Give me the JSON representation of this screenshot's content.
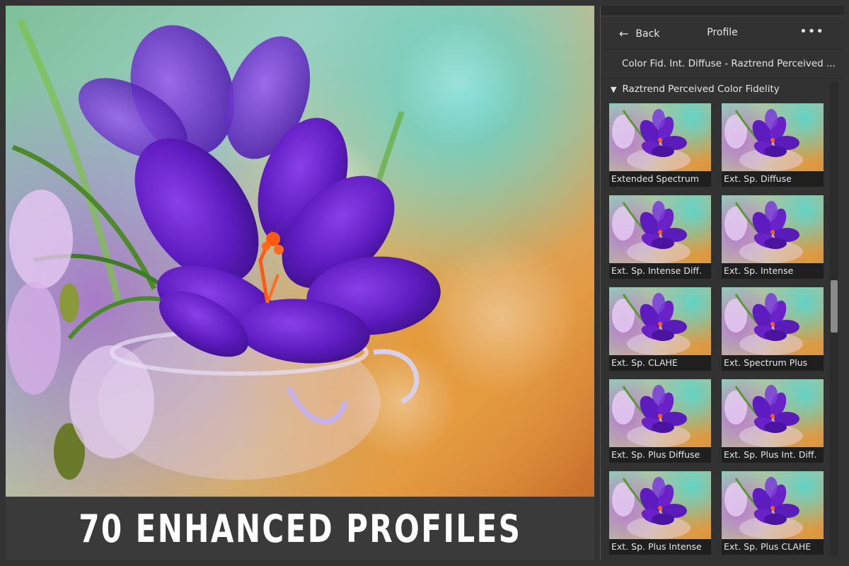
{
  "banner": {
    "text": "70 ENHANCED PROFILES"
  },
  "panel": {
    "back_label": "Back",
    "title": "Profile",
    "more_label": "•••",
    "current_profile": "Color Fid. Int. Diffuse - Raztrend Perceived ...",
    "group_title": "Raztrend Perceived Color Fidelity",
    "thumbnails": [
      {
        "label": "Extended Spectrum"
      },
      {
        "label": "Ext. Sp. Diffuse"
      },
      {
        "label": "Ext. Sp. Intense Diff."
      },
      {
        "label": "Ext. Sp. Intense"
      },
      {
        "label": "Ext. Sp. CLAHE"
      },
      {
        "label": "Ext. Spectrum Plus"
      },
      {
        "label": "Ext. Sp. Plus Diffuse"
      },
      {
        "label": "Ext. Sp. Plus Int. Diff."
      },
      {
        "label": "Ext. Sp. Plus Intense"
      },
      {
        "label": "Ext. Sp. Plus CLAHE"
      }
    ]
  },
  "icons": {
    "back": "arrow-left-icon",
    "more": "more-horizontal-icon",
    "group_toggle": "triangle-down-icon"
  },
  "colors": {
    "panel_bg": "#323232",
    "label_bg": "#1f1f1f",
    "banner_bg": "#3a3a3a",
    "flower_purple": "#6a22c8",
    "stamen_orange": "#ff5a10"
  }
}
